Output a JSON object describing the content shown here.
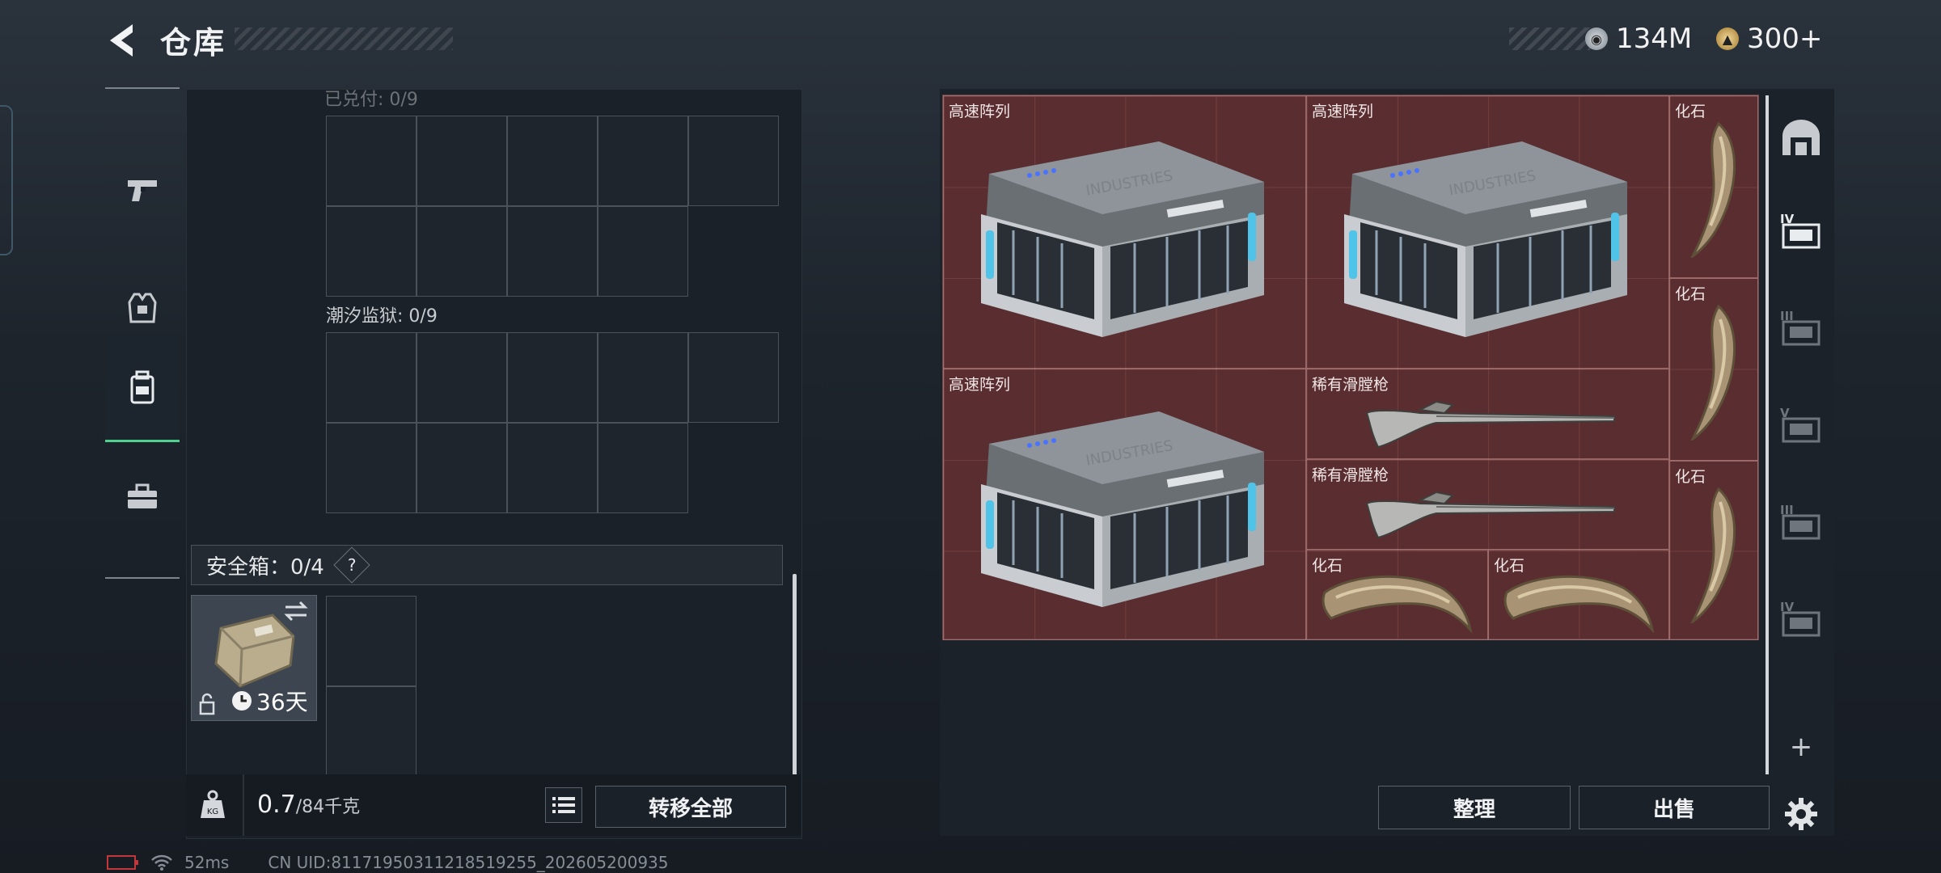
{
  "header": {
    "title": "仓库",
    "currencies": [
      {
        "icon": "silver-coin-icon",
        "value": "134M"
      },
      {
        "icon": "gold-coin-icon",
        "value": "300+"
      }
    ]
  },
  "rail": {
    "items": [
      {
        "name": "weapons",
        "icon": "pistol-icon"
      },
      {
        "name": "armor",
        "icon": "vest-icon"
      },
      {
        "name": "backpack",
        "icon": "backpack-icon",
        "active": true
      },
      {
        "name": "equipment",
        "icon": "toolbox-icon"
      }
    ]
  },
  "left": {
    "section1_label": "已兑付: 0/9",
    "section2_label": "潮汐监狱: 0/9",
    "safe_box_label": "安全箱：0/4",
    "safe_box_help": "?",
    "safe_item_timer": "36天",
    "weight_current": "0.7",
    "weight_max": "/84千克",
    "transfer_all": "转移全部"
  },
  "storage": {
    "items": [
      {
        "name": "高速阵列",
        "kind": "server"
      },
      {
        "name": "高速阵列",
        "kind": "server"
      },
      {
        "name": "化石",
        "kind": "claw"
      },
      {
        "name": "化石",
        "kind": "claw"
      },
      {
        "name": "高速阵列",
        "kind": "server"
      },
      {
        "name": "稀有滑膛枪",
        "kind": "musket"
      },
      {
        "name": "稀有滑膛枪",
        "kind": "musket"
      },
      {
        "name": "化石",
        "kind": "claw"
      },
      {
        "name": "化石",
        "kind": "claw-flat"
      },
      {
        "name": "化石",
        "kind": "claw-flat"
      }
    ],
    "sort_button": "整理",
    "sell_button": "出售"
  },
  "tabs": [
    {
      "icon": "warehouse-icon"
    },
    {
      "icon": "storage-iv-icon",
      "roman": "IV",
      "active": true
    },
    {
      "icon": "storage-iii-icon",
      "roman": "III"
    },
    {
      "icon": "storage-v-icon",
      "roman": "V"
    },
    {
      "icon": "storage-iii-b-icon",
      "roman": "III"
    },
    {
      "icon": "storage-iv-b-icon",
      "roman": "IV"
    }
  ],
  "footer": {
    "ping": "52ms",
    "uid": "CN UID:81171950311218519255_202605200935"
  },
  "colors": {
    "accent_green": "#4fd28f",
    "storage_bg": "#5a2e30",
    "panel_bg": "#1b2128"
  }
}
